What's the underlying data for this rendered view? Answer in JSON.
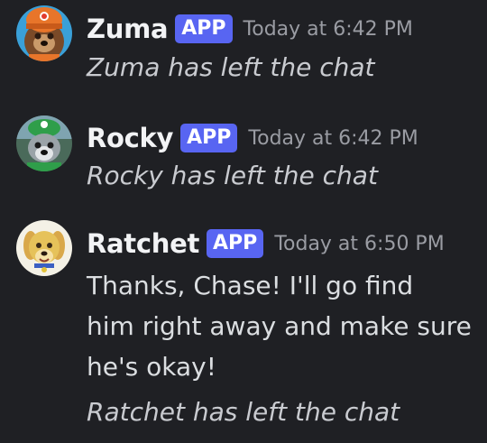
{
  "messages": [
    {
      "author": "Zuma",
      "badge": "APP",
      "timestamp": "Today at 6:42 PM",
      "system_text": "Zuma has left the chat"
    },
    {
      "author": "Rocky",
      "badge": "APP",
      "timestamp": "Today at 6:42 PM",
      "system_text": "Rocky has left the chat"
    },
    {
      "author": "Ratchet",
      "badge": "APP",
      "timestamp": "Today at 6:50 PM",
      "body_lines": [
        "Thanks, Chase!  I'll go find",
        "him right away and make sure",
        "he's okay!"
      ],
      "system_text": "Ratchet has left the chat"
    }
  ],
  "avatars": [
    {
      "icon": "zuma-avatar-icon",
      "accent": "#e8752a"
    },
    {
      "icon": "rocky-avatar-icon",
      "accent": "#2f9e4a"
    },
    {
      "icon": "ratchet-avatar-icon",
      "accent": "#e6c25a"
    }
  ],
  "colors": {
    "background": "#1f2024",
    "badge": "#5865f2",
    "timestamp": "#9a9ca3"
  }
}
